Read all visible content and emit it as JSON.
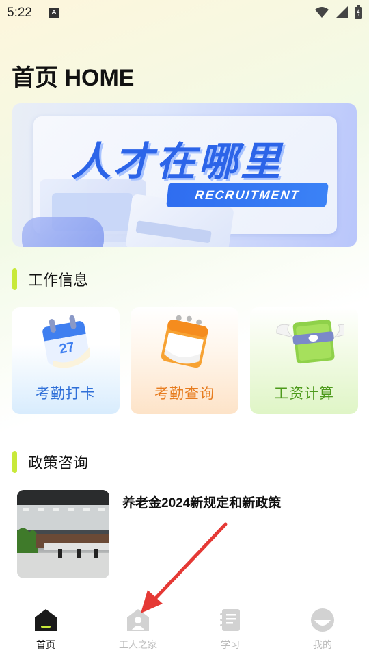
{
  "status_bar": {
    "time": "5:22",
    "notification_icon": "A"
  },
  "page": {
    "title": "首页 HOME"
  },
  "banner": {
    "headline": "人才在哪里",
    "tag": "RECRUITMENT"
  },
  "sections": {
    "work_info": "工作信息",
    "policy": "政策咨询"
  },
  "work_cards": [
    {
      "label": "考勤打卡",
      "icon": "calendar-icon",
      "calendar_number": "27"
    },
    {
      "label": "考勤查询",
      "icon": "calendar-notebook-icon"
    },
    {
      "label": "工资计算",
      "icon": "winged-money-icon"
    }
  ],
  "news": [
    {
      "title": "养老金2024新规定和新政策",
      "thumb": "office-photo"
    }
  ],
  "tabs": [
    {
      "label": "首页",
      "icon": "home-icon",
      "active": true
    },
    {
      "label": "工人之家",
      "icon": "worker-house-icon",
      "active": false
    },
    {
      "label": "学习",
      "icon": "book-icon",
      "active": false
    },
    {
      "label": "我的",
      "icon": "profile-icon",
      "active": false
    }
  ],
  "colors": {
    "accent_green": "#c8e93a",
    "blue": "#2f6fd8",
    "orange": "#e77c1f",
    "green": "#4d9a1c",
    "arrow_red": "#e53935"
  }
}
